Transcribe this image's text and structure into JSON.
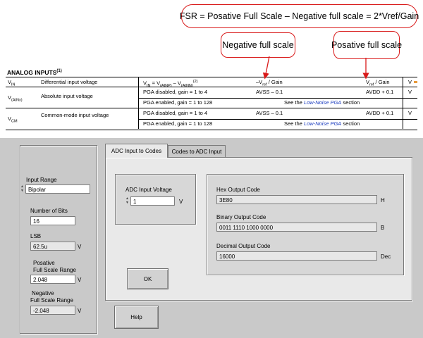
{
  "annotations": {
    "fsr_formula": "FSR = Posative Full Scale – Negative full scale = 2*Vref/Gain",
    "negative_full_scale": "Negative full scale",
    "positive_full_scale": "Posative full scale",
    "color": "#d91a1a"
  },
  "spec_table": {
    "section_title": "ANALOG INPUTS",
    "section_title_note": "(1)",
    "rows": [
      {
        "symbol": "V",
        "symbol_sub": "IN",
        "parameter": "Differential input voltage",
        "cond_prefix": "V",
        "cond_sub1": "IN",
        "cond_mid": " = V",
        "cond_sub2": "(AINP)",
        "cond_mid2": " – V",
        "cond_sub3": "(AINN)",
        "cond_note": "(2)",
        "min_prefix": "–V",
        "min_sub": "ref",
        "min_suffix": " / Gain",
        "max_prefix": "V",
        "max_sub": "ref",
        "max_suffix": " / Gain",
        "unit": "V"
      },
      {
        "symbol": "V",
        "symbol_sub": "(AINx)",
        "parameter": "Absolute input voltage",
        "cond_a": "PGA disabled, gain = 1 to 4",
        "min_a": "AVSS – 0.1",
        "max_a": "AVDD + 0.1",
        "unit": "V",
        "cond_b": "PGA enabled, gain = 1 to 128",
        "see_prefix": "See the ",
        "see_link": "Low-Noise PGA",
        "see_suffix": " section"
      },
      {
        "symbol": "V",
        "symbol_sub": "CM",
        "parameter": "Common-mode input voltage",
        "cond_a": "PGA disabled, gain = 1 to 4",
        "min_a": "AVSS – 0.1",
        "max_a": "AVDD + 0.1",
        "unit": "V",
        "cond_b": "PGA enabled, gain = 1 to 128",
        "see_prefix": "See the ",
        "see_link": "Low-Noise PGA",
        "see_suffix": " section"
      }
    ]
  },
  "left_panel": {
    "input_range_label": "Input Range",
    "input_range_value": "Bipolar",
    "bits_label": "Number of Bits",
    "bits_value": "16",
    "lsb_label": "LSB",
    "lsb_value": "62.5u",
    "lsb_unit": "V",
    "pos_fsr_label_1": "Posative",
    "pos_fsr_label_2": "Full Scale Range",
    "pos_fsr_value": "2.048",
    "pos_fsr_unit": "V",
    "neg_fsr_label_1": "Negative",
    "neg_fsr_label_2": "Full Scale Range",
    "neg_fsr_value": "-2.048",
    "neg_fsr_unit": "V"
  },
  "tabs": [
    {
      "label": "ADC Input to Codes",
      "active": true
    },
    {
      "label": "Codes to ADC Input",
      "active": false
    }
  ],
  "adc_tab": {
    "input_label": "ADC Input Voltage",
    "input_value": "1",
    "input_unit": "V",
    "hex_label": "Hex Output Code",
    "hex_value": "3E80",
    "hex_unit": "H",
    "bin_label": "Binary Output Code",
    "bin_value": "0011 1110 1000 0000",
    "bin_unit": "B",
    "dec_label": "Decimal Output Code",
    "dec_value": "16000",
    "dec_unit": "Dec",
    "ok_label": "OK"
  },
  "help_label": "Help"
}
